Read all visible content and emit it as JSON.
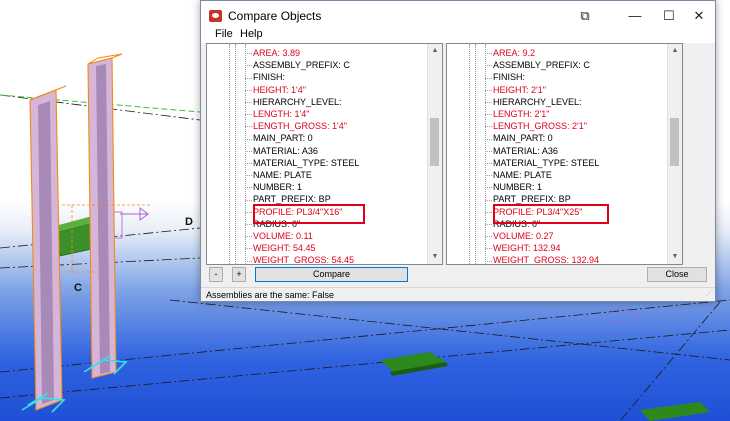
{
  "window": {
    "title": "Compare Objects",
    "icons": {
      "app": "tekla-app-icon",
      "restore": "restore-icon",
      "minimize": "minimize-icon",
      "maximize": "maximize-icon",
      "close": "close-icon"
    },
    "glyphs": {
      "restore": "⧉",
      "minimize": "—",
      "maximize": "☐",
      "close": "✕"
    }
  },
  "menu": {
    "file": "File",
    "help": "Help"
  },
  "left_panel": {
    "rows": [
      {
        "text": "AREA: 3.89",
        "red": true
      },
      {
        "text": "ASSEMBLY_PREFIX: C",
        "red": false
      },
      {
        "text": "FINISH:",
        "red": false
      },
      {
        "text": "HEIGHT: 1'4\"",
        "red": true
      },
      {
        "text": "HIERARCHY_LEVEL:",
        "red": false
      },
      {
        "text": "LENGTH: 1'4\"",
        "red": true
      },
      {
        "text": "LENGTH_GROSS: 1'4\"",
        "red": true
      },
      {
        "text": "MAIN_PART: 0",
        "red": false
      },
      {
        "text": "MATERIAL: A36",
        "red": false
      },
      {
        "text": "MATERIAL_TYPE: STEEL",
        "red": false
      },
      {
        "text": "NAME: PLATE",
        "red": false
      },
      {
        "text": "NUMBER: 1",
        "red": false
      },
      {
        "text": "PART_PREFIX: BP",
        "red": false
      },
      {
        "text": "PROFILE: PL3/4\"X16\"",
        "red": true
      },
      {
        "text": "RADIUS: 0\"",
        "red": false
      },
      {
        "text": "VOLUME: 0.11",
        "red": true
      },
      {
        "text": "WEIGHT: 54.45",
        "red": true
      },
      {
        "text": "WEIGHT_GROSS: 54.45",
        "red": true
      }
    ]
  },
  "right_panel": {
    "rows": [
      {
        "text": "AREA: 9.2",
        "red": true
      },
      {
        "text": "ASSEMBLY_PREFIX: C",
        "red": false
      },
      {
        "text": "FINISH:",
        "red": false
      },
      {
        "text": "HEIGHT: 2'1\"",
        "red": true
      },
      {
        "text": "HIERARCHY_LEVEL:",
        "red": false
      },
      {
        "text": "LENGTH: 2'1\"",
        "red": true
      },
      {
        "text": "LENGTH_GROSS: 2'1\"",
        "red": true
      },
      {
        "text": "MAIN_PART: 0",
        "red": false
      },
      {
        "text": "MATERIAL: A36",
        "red": false
      },
      {
        "text": "MATERIAL_TYPE: STEEL",
        "red": false
      },
      {
        "text": "NAME: PLATE",
        "red": false
      },
      {
        "text": "NUMBER: 1",
        "red": false
      },
      {
        "text": "PART_PREFIX: BP",
        "red": false
      },
      {
        "text": "PROFILE: PL3/4\"X25\"",
        "red": true
      },
      {
        "text": "RADIUS: 0\"",
        "red": false
      },
      {
        "text": "VOLUME: 0.27",
        "red": true
      },
      {
        "text": "WEIGHT: 132.94",
        "red": true
      },
      {
        "text": "WEIGHT_GROSS: 132.94",
        "red": true
      }
    ]
  },
  "scroll_glyphs": {
    "up": "▲",
    "down": "▼"
  },
  "buttons": {
    "minus": "-",
    "plus": "+",
    "compare": "Compare",
    "close": "Close"
  },
  "status": "Assemblies are the same: False",
  "viewport": {
    "labels": {
      "d": "D",
      "c": "C"
    }
  },
  "colors": {
    "diff_red": "#e0001b",
    "highlight_box": "#e0001b",
    "accent": "#0078d7"
  }
}
